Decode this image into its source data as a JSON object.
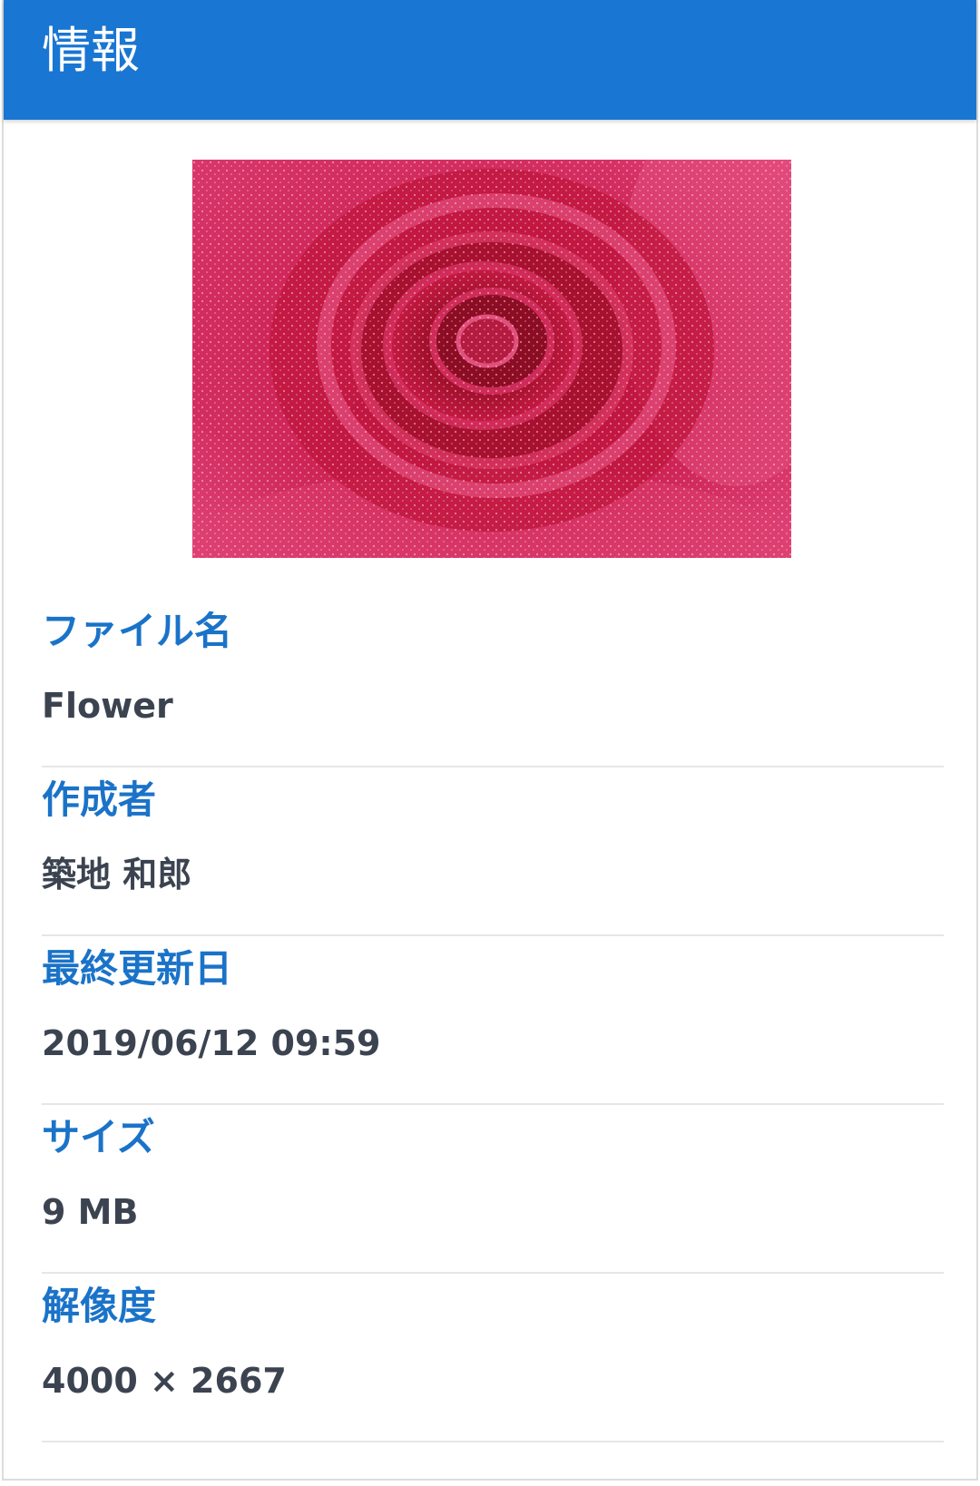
{
  "header": {
    "title": "情報"
  },
  "image": {
    "subject": "red rose with water droplets"
  },
  "info": [
    {
      "label": "ファイル名",
      "value": "Flower"
    },
    {
      "label": "作成者",
      "value": "築地 和郎"
    },
    {
      "label": "最終更新日",
      "value": "2019/06/12 09:59"
    },
    {
      "label": "サイズ",
      "value": "9 MB"
    },
    {
      "label": "解像度",
      "value": "4000 × 2667"
    }
  ],
  "colors": {
    "header_bg": "#1976d2",
    "label": "#1a73c8",
    "value": "#3c4350"
  }
}
